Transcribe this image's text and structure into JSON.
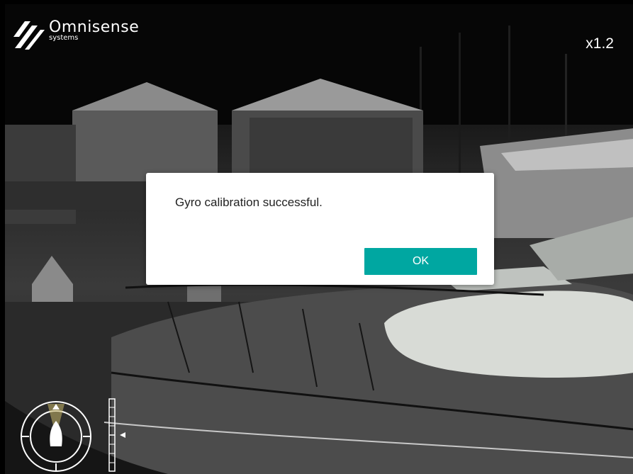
{
  "brand": {
    "name": "Omnisense",
    "sub": "systems"
  },
  "zoom": {
    "label": "x1.2"
  },
  "dialog": {
    "message": "Gyro calibration successful.",
    "ok_label": "OK"
  },
  "colors": {
    "accent": "#00a7a1",
    "compass_cone": "#c9b86a",
    "hud": "#ffffff"
  },
  "icons": [
    "omnisense-logo-icon",
    "compass-icon",
    "boat-heading-icon",
    "tilt-gauge-icon",
    "pointer-arrow-icon"
  ]
}
